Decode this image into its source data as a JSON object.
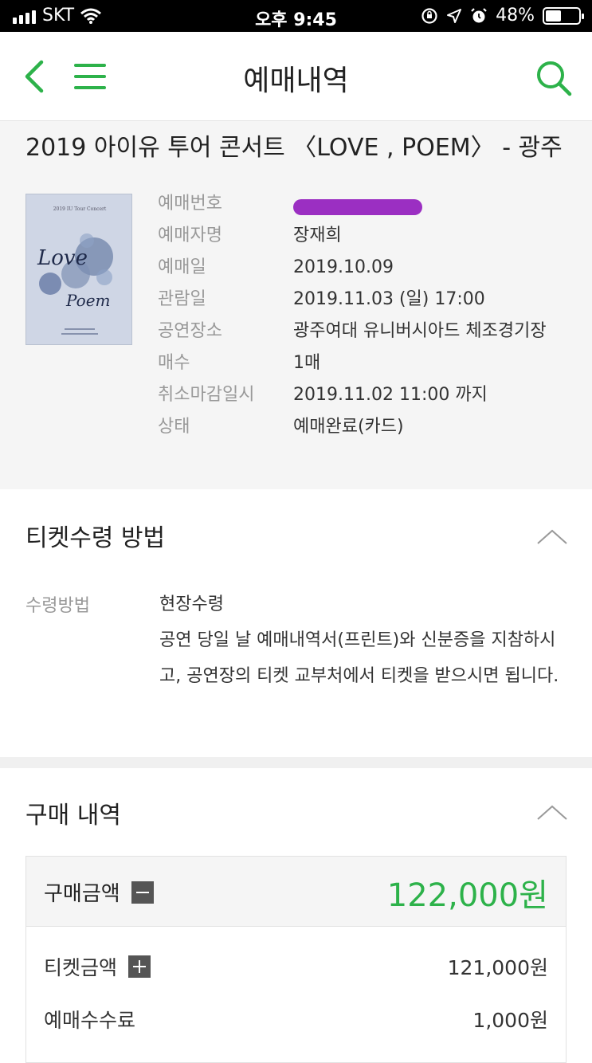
{
  "status_bar": {
    "carrier": "SKT",
    "time": "오후 9:45",
    "battery": "48%",
    "battery_level": 0.48
  },
  "nav": {
    "title": "예매내역"
  },
  "booking": {
    "concert_title": "2019 아이유 투어 콘서트 〈LOVE ,  POEM〉 - 광주",
    "poster_text": {
      "header": "2019 IU Tour Concert",
      "word1": "Love",
      "word2": "Poem"
    },
    "rows": [
      {
        "label": "예매번호",
        "value": ""
      },
      {
        "label": "예매자명",
        "value": "장재희"
      },
      {
        "label": "예매일",
        "value": "2019.10.09"
      },
      {
        "label": "관람일",
        "value": "2019.11.03 (일) 17:00"
      },
      {
        "label": "공연장소",
        "value": "광주여대 유니버시아드 체조경기장"
      },
      {
        "label": "매수",
        "value": "1매"
      },
      {
        "label": "취소마감일시",
        "value": "2019.11.02 11:00 까지"
      },
      {
        "label": "상태",
        "value": "예매완료(카드)"
      }
    ]
  },
  "receive": {
    "title": "티켓수령 방법",
    "method_label": "수령방법",
    "method_value": "현장수령",
    "description": "공연 당일 날 예매내역서(프린트)와 신분증을 지참하시고, 공연장의 티켓 교부처에서 티켓을 받으시면 됩니다."
  },
  "purchase": {
    "title": "구매 내역",
    "total_label": "구매금액",
    "total_amount": "122,000원",
    "items": [
      {
        "label": "티켓금액",
        "amount": "121,000원",
        "icon": "plus-box-icon"
      },
      {
        "label": "예매수수료",
        "amount": "1,000원",
        "icon": ""
      }
    ]
  },
  "colors": {
    "accent": "#2db24a",
    "redaction": "#9b2fc2"
  }
}
